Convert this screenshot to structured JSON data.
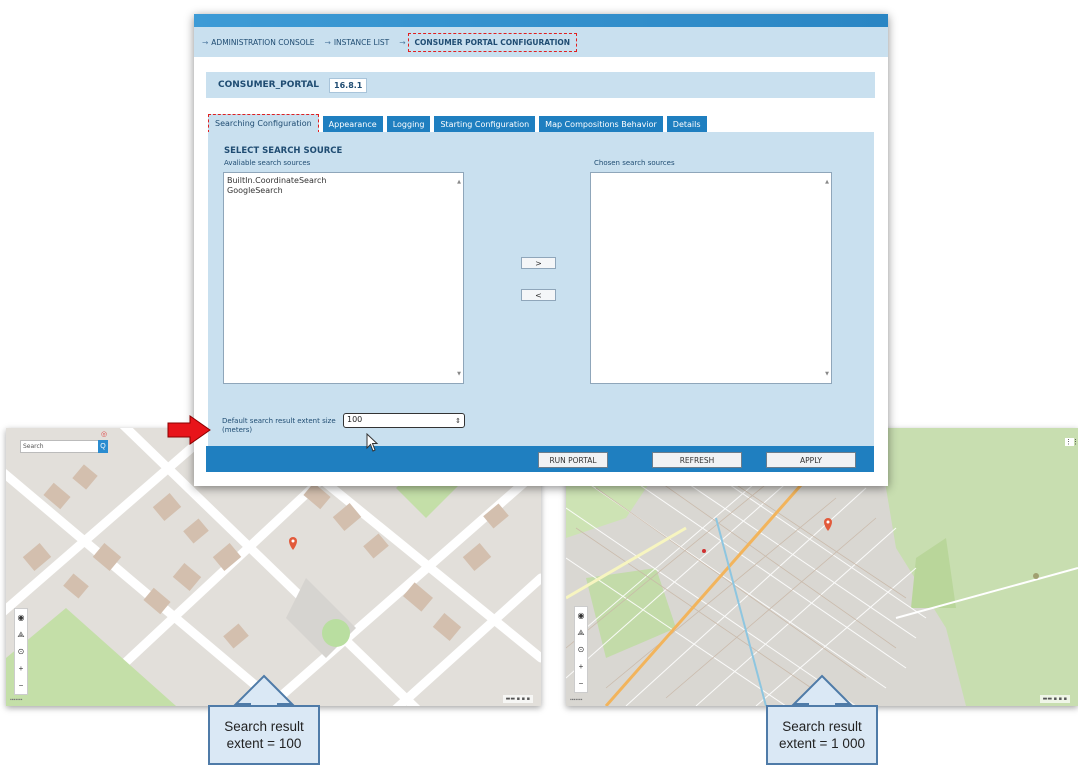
{
  "breadcrumb": {
    "items": [
      "ADMINISTRATION CONSOLE",
      "INSTANCE LIST",
      "CONSUMER PORTAL CONFIGURATION"
    ]
  },
  "portal": {
    "name": "CONSUMER_PORTAL",
    "version": "16.8.1"
  },
  "tabs": [
    "Searching Configuration",
    "Appearance",
    "Logging",
    "Starting Configuration",
    "Map Compositions Behavior",
    "Details"
  ],
  "search_source": {
    "title": "SELECT SEARCH SOURCE",
    "available_label": "Avaliable search sources",
    "chosen_label": "Chosen search sources",
    "available": [
      "BuiltIn.CoordinateSearch",
      "GoogleSearch"
    ],
    "chosen": [],
    "add_label": ">",
    "remove_label": "<"
  },
  "extent": {
    "label": "Default search result extent size (meters)",
    "value": "100"
  },
  "footer": {
    "run_label": "RUN PORTAL",
    "refresh_label": "REFRESH",
    "apply_label": "APPLY"
  },
  "callouts": {
    "left": {
      "line1": "Search result",
      "line2": "extent = 100"
    },
    "right": {
      "line1": "Search result",
      "line2": "extent = 1 000"
    }
  },
  "maps": {
    "left_search_placeholder": "Search",
    "search_button": "Q"
  },
  "colors": {
    "accent": "#1f7fc0",
    "panel": "#c9e0ef",
    "highlight": "#e02020",
    "callout_fill": "#dae8f5",
    "callout_border": "#4f7ba8"
  }
}
